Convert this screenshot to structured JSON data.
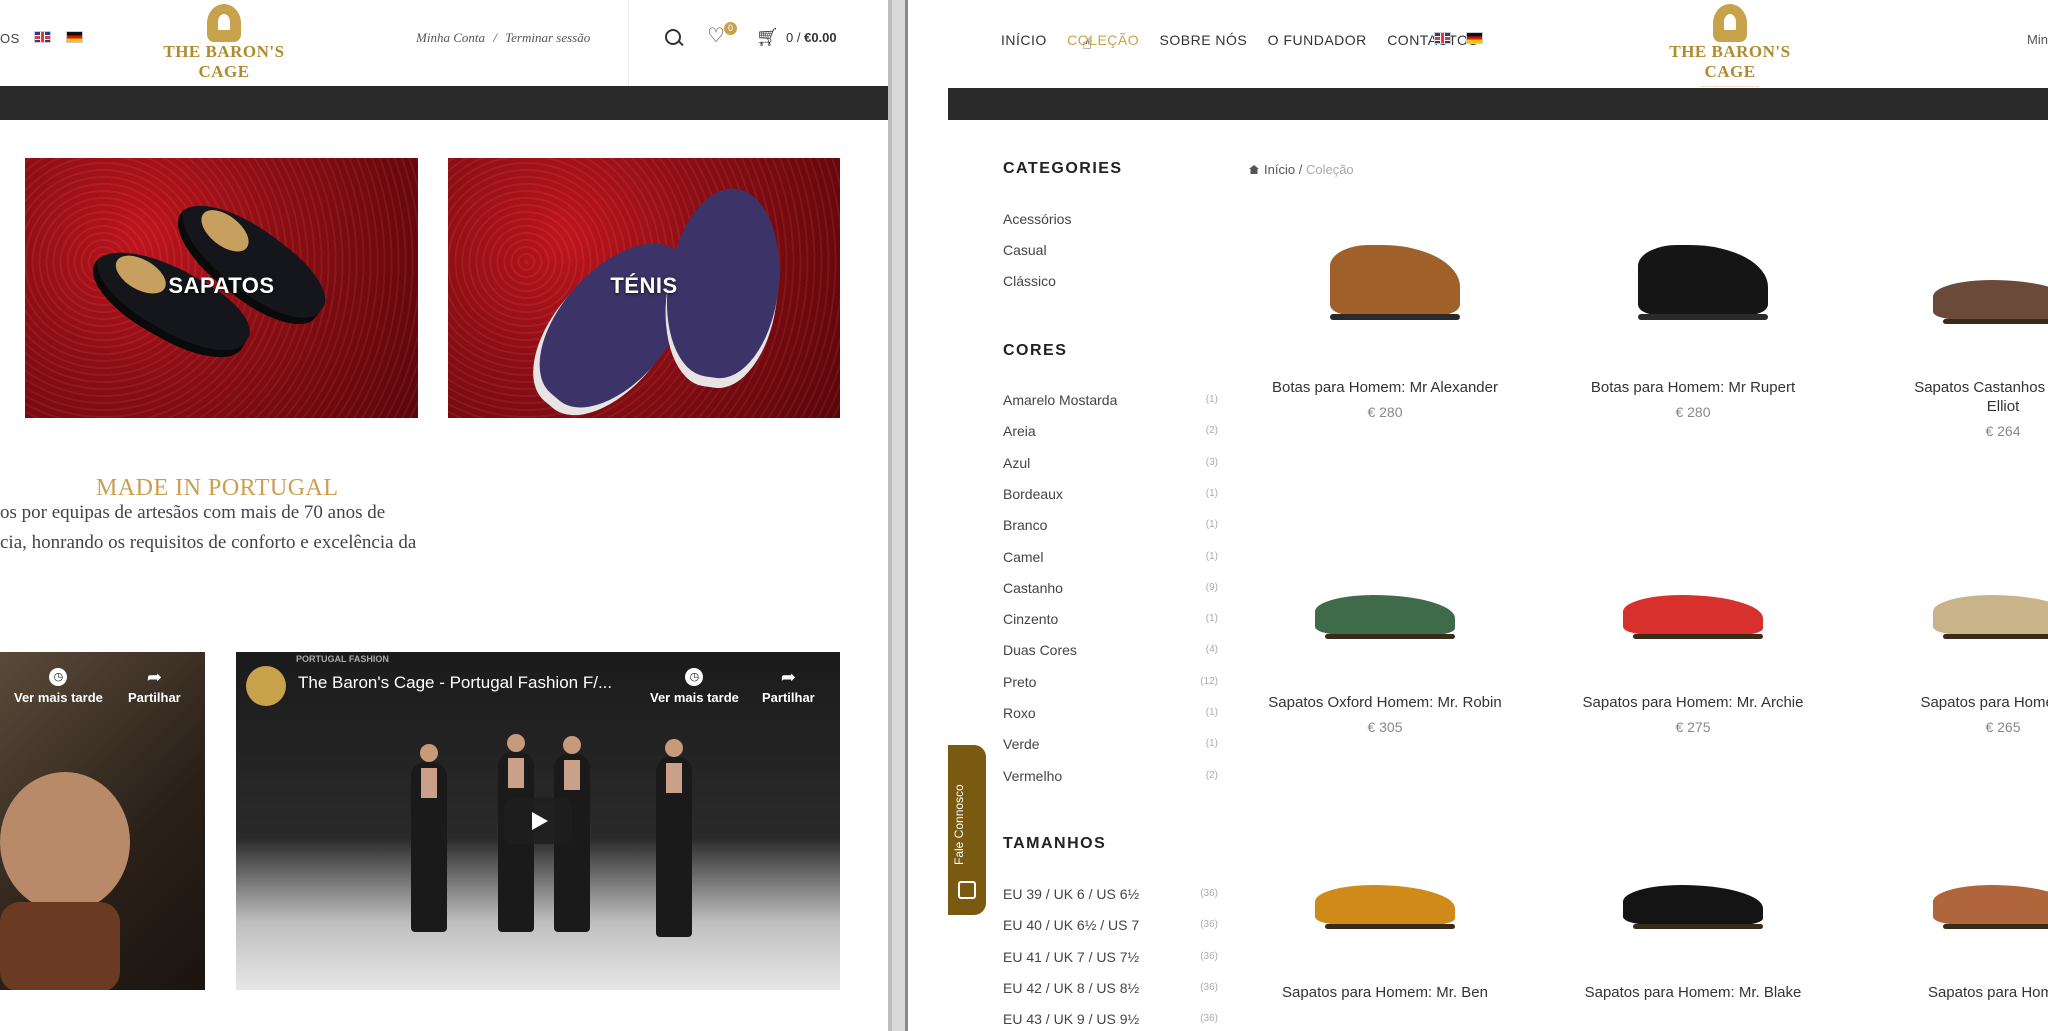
{
  "left": {
    "nav_fragment": "OS",
    "logo": {
      "brand": "THE BARON'S CAGE"
    },
    "account": {
      "my_account": "Minha Conta",
      "separator": "/",
      "logout": "Terminar sessão"
    },
    "wishlist_count": "0",
    "cart": {
      "count": "0",
      "separator": "/",
      "total": "€0.00"
    },
    "categories": [
      {
        "label": "SAPATOS"
      },
      {
        "label": "TÉNIS"
      }
    ],
    "made_in": {
      "title": "MADE IN PORTUGAL",
      "line1": "os por equipas de artesãos com mais de 70 anos de",
      "line2": "cia, honrando os requisitos de conforto e excelência da"
    },
    "video1": {
      "watch_later": "Ver mais tarde",
      "share": "Partilhar"
    },
    "video2": {
      "title": "The Baron's Cage - Portugal Fashion F/...",
      "watch_later": "Ver mais tarde",
      "share": "Partilhar",
      "overlay_text": "PORTUGAL FASHION"
    }
  },
  "right": {
    "menu": [
      "INÍCIO",
      "COLEÇÃO",
      "SOBRE NÓS",
      "O FUNDADOR",
      "CONTACTOS"
    ],
    "logo": {
      "brand": "THE BARON'S CAGE"
    },
    "mini_text": "Min",
    "sidebar": {
      "categories_title": "CATEGORIES",
      "categories": [
        "Acessórios",
        "Casual",
        "Clássico"
      ],
      "colors_title": "CORES",
      "colors": [
        {
          "name": "Amarelo Mostarda",
          "count": "(1)"
        },
        {
          "name": "Areia",
          "count": "(2)"
        },
        {
          "name": "Azul",
          "count": "(3)"
        },
        {
          "name": "Bordeaux",
          "count": "(1)"
        },
        {
          "name": "Branco",
          "count": "(1)"
        },
        {
          "name": "Camel",
          "count": "(1)"
        },
        {
          "name": "Castanho",
          "count": "(9)"
        },
        {
          "name": "Cinzento",
          "count": "(1)"
        },
        {
          "name": "Duas Cores",
          "count": "(4)"
        },
        {
          "name": "Preto",
          "count": "(12)"
        },
        {
          "name": "Roxo",
          "count": "(1)"
        },
        {
          "name": "Verde",
          "count": "(1)"
        },
        {
          "name": "Vermelho",
          "count": "(2)"
        }
      ],
      "sizes_title": "TAMANHOS",
      "sizes": [
        {
          "name": "EU 39 / UK 6 / US 6½",
          "count": "(36)"
        },
        {
          "name": "EU 40 / UK 6½ / US 7",
          "count": "(36)"
        },
        {
          "name": "EU 41 / UK 7 / US 7½",
          "count": "(36)"
        },
        {
          "name": "EU 42 / UK 8 / US 8½",
          "count": "(36)"
        },
        {
          "name": "EU 43 / UK 9 / US 9½",
          "count": "(36)"
        }
      ]
    },
    "breadcrumb": {
      "home": "Início",
      "separator": "/",
      "current": "Coleção"
    },
    "products": [
      {
        "name": "Botas para Homem: Mr Alexander",
        "price": "€ 280",
        "color": "#a0602a",
        "kind": "boot"
      },
      {
        "name": "Botas para Homem: Mr Rupert",
        "price": "€ 280",
        "color": "#151515",
        "kind": "boot"
      },
      {
        "name": "Sapatos Castanhos Loafer",
        "name2": "Elliot",
        "price": "€ 264",
        "color": "#6b4a3a",
        "kind": "shoe"
      },
      {
        "name": "Sapatos Oxford Homem: Mr. Robin",
        "price": "€ 305",
        "color": "#3f6b4a",
        "kind": "shoe"
      },
      {
        "name": "Sapatos para Homem: Mr. Archie",
        "price": "€ 275",
        "color": "#d8302c",
        "kind": "shoe"
      },
      {
        "name": "Sapatos para Homem: N",
        "price": "€ 265",
        "color": "#c9b48a",
        "kind": "shoe"
      },
      {
        "name": "Sapatos para Homem: Mr. Ben",
        "price": "",
        "color": "#d08a1a",
        "kind": "shoe"
      },
      {
        "name": "Sapatos para Homem: Mr. Blake",
        "price": "",
        "color": "#141414",
        "kind": "shoe"
      },
      {
        "name": "Sapatos para Homem:",
        "price": "",
        "color": "#b0663a",
        "kind": "shoe"
      }
    ],
    "contact_tab": "Fale Connosco"
  },
  "colors": {
    "gold": "#c8a24a",
    "dark_bar": "#2a2a2a",
    "burgundy": "#8e0e14"
  }
}
